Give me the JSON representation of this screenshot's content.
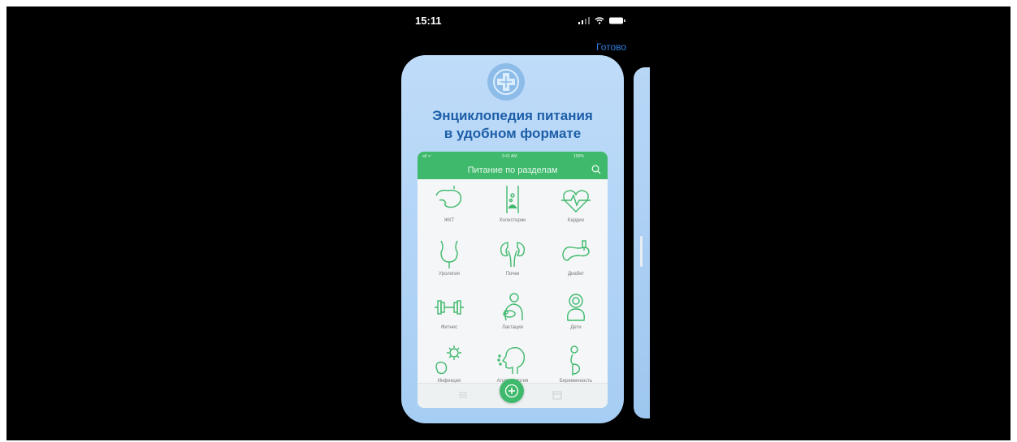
{
  "status_bar": {
    "time": "15:11",
    "icons": [
      "signal-icon",
      "wifi-icon",
      "battery-icon"
    ]
  },
  "nav": {
    "done_label": "Готово"
  },
  "promo": {
    "headline_line1": "Энциклопедия питания",
    "headline_line2": "в удобном формате",
    "logo_icon": "medical-cross-icon"
  },
  "app": {
    "title": "Питание по разделам",
    "mini_status": {
      "left": "all ᯤ",
      "time": "9:41 AM",
      "right": "100%"
    },
    "sections": [
      {
        "label": "ЖКТ",
        "icon": "stomach-icon"
      },
      {
        "label": "Холестерин",
        "icon": "artery-icon"
      },
      {
        "label": "Кардио",
        "icon": "heart-icon"
      },
      {
        "label": "Урология",
        "icon": "bladder-icon"
      },
      {
        "label": "Почки",
        "icon": "kidneys-icon"
      },
      {
        "label": "Диабет",
        "icon": "pancreas-icon"
      },
      {
        "label": "Фитнес",
        "icon": "dumbbell-icon"
      },
      {
        "label": "Лактация",
        "icon": "breastfeeding-icon"
      },
      {
        "label": "Дети",
        "icon": "baby-icon"
      },
      {
        "label": "Инфекция",
        "icon": "virus-icon"
      },
      {
        "label": "Аллергология",
        "icon": "allergy-head-icon"
      },
      {
        "label": "Беременность",
        "icon": "pregnancy-icon"
      }
    ],
    "tabbar": {
      "icons": [
        "list-icon",
        "add-icon",
        "calendar-icon"
      ]
    }
  },
  "colors": {
    "background": "#000000",
    "card": "#bfdcf9",
    "headline": "#1d5ea8",
    "accent_green": "#3fb96c",
    "link_blue": "#2f7fe0"
  }
}
